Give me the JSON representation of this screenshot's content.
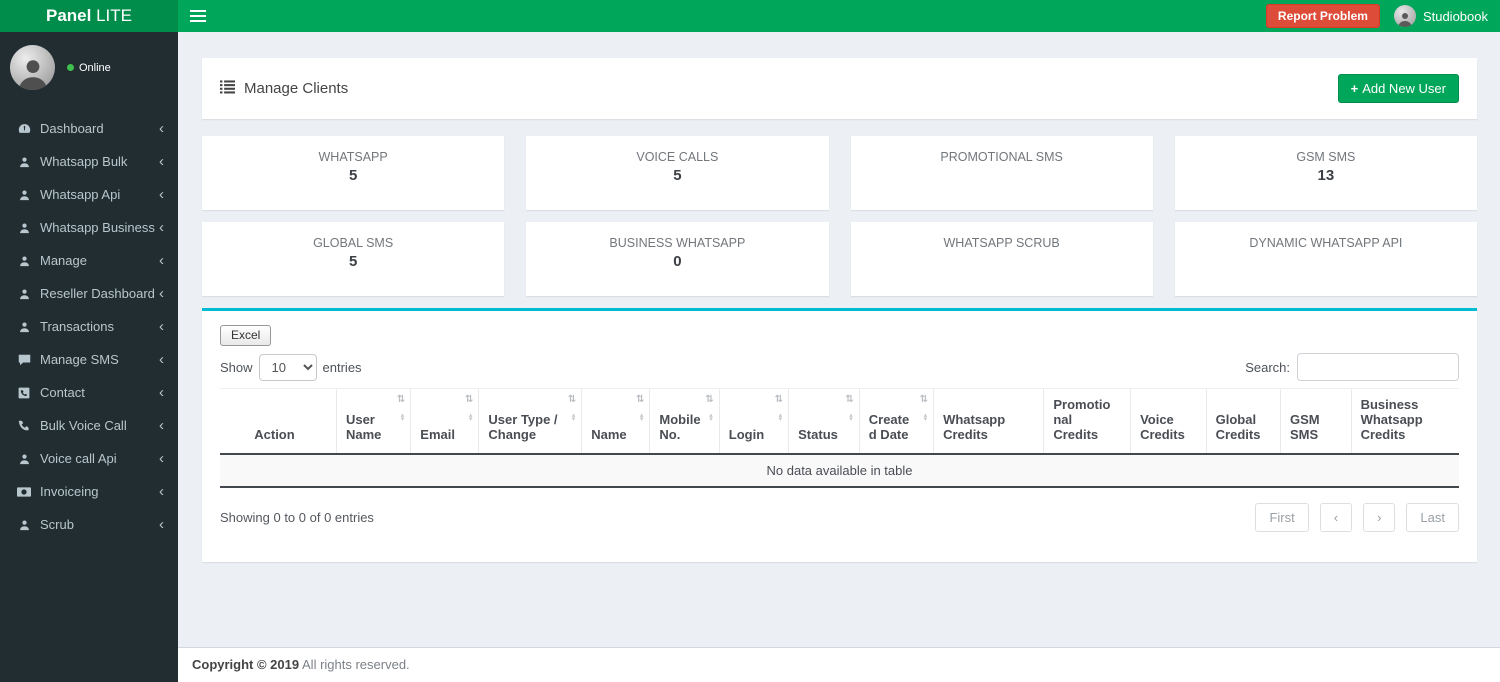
{
  "navbar": {
    "brand_bold": "Panel",
    "brand_light": " LITE",
    "report_problem_label": "Report Problem",
    "username": "Studiobook"
  },
  "sidebar": {
    "status_label": "Online",
    "items": [
      {
        "label": "Dashboard",
        "icon": "tachometer-icon"
      },
      {
        "label": "Whatsapp Bulk",
        "icon": "user-icon"
      },
      {
        "label": "Whatsapp Api",
        "icon": "user-icon"
      },
      {
        "label": "Whatsapp Business",
        "icon": "user-icon"
      },
      {
        "label": "Manage",
        "icon": "user-icon"
      },
      {
        "label": "Reseller Dashboard",
        "icon": "user-icon"
      },
      {
        "label": "Transactions",
        "icon": "user-icon"
      },
      {
        "label": "Manage SMS",
        "icon": "comment-icon"
      },
      {
        "label": "Contact",
        "icon": "phone-square-icon"
      },
      {
        "label": "Bulk Voice Call",
        "icon": "phone-icon"
      },
      {
        "label": "Voice call Api",
        "icon": "user-icon"
      },
      {
        "label": "Invoiceing",
        "icon": "money-icon"
      },
      {
        "label": "Scrub",
        "icon": "user-icon"
      }
    ]
  },
  "page": {
    "title": "Manage Clients",
    "add_user_plus": "+",
    "add_user_label": "Add New User"
  },
  "stats": [
    {
      "label": "WHATSAPP",
      "value": "5"
    },
    {
      "label": "VOICE CALLS",
      "value": "5"
    },
    {
      "label": "PROMOTIONAL SMS",
      "value": ""
    },
    {
      "label": "GSM SMS",
      "value": "13"
    },
    {
      "label": "GLOBAL SMS",
      "value": "5"
    },
    {
      "label": "BUSINESS WHATSAPP",
      "value": "0"
    },
    {
      "label": "WHATSAPP SCRUB",
      "value": ""
    },
    {
      "label": "DYNAMIC WHATSAPP API",
      "value": ""
    }
  ],
  "table": {
    "excel_label": "Excel",
    "show_label": "Show",
    "entries_label": "entries",
    "page_length": "10",
    "search_label": "Search:",
    "search_value": "",
    "columns": [
      {
        "label": "Action",
        "sortable": false
      },
      {
        "label": "User Name",
        "sortable": true
      },
      {
        "label": "Email",
        "sortable": true
      },
      {
        "label": "User Type / Change",
        "sortable": true
      },
      {
        "label": "Name",
        "sortable": true
      },
      {
        "label": "Mobile No.",
        "sortable": true
      },
      {
        "label": "Login",
        "sortable": true
      },
      {
        "label": "Status",
        "sortable": true
      },
      {
        "label": "Created Date",
        "sortable": true
      },
      {
        "label": "Whatsapp Credits",
        "sortable": false
      },
      {
        "label": "Promotional Credits",
        "sortable": false
      },
      {
        "label": "Voice Credits",
        "sortable": false
      },
      {
        "label": "Global Credits",
        "sortable": false
      },
      {
        "label": "GSM SMS",
        "sortable": false
      },
      {
        "label": "Business Whatsapp Credits",
        "sortable": false
      }
    ],
    "empty_message": "No data available in table",
    "info_text": "Showing 0 to 0 of 0 entries",
    "pagination": [
      "First",
      "‹",
      "›",
      "Last"
    ]
  },
  "footer": {
    "bold": "Copyright © 2019",
    "regular": "All rights reserved."
  },
  "colors": {
    "navbar_green": "#00a65a",
    "logo_green": "#008d4c",
    "sidebar_dark": "#222d32",
    "danger_red": "#dd4b39",
    "info_cyan": "#00bcd1",
    "content_bg": "#ecf0f5"
  }
}
